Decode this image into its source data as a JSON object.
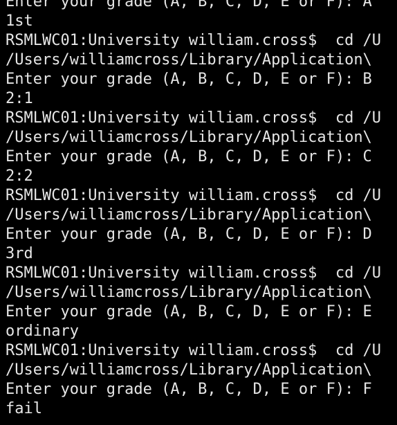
{
  "terminal": {
    "colors": {
      "background": "#000000",
      "foreground": "#e6e6e6"
    },
    "lines": [
      "Enter your grade (A, B, C, D, E or F): A",
      "1st",
      "RSMLWC01:University william.cross$  cd /U",
      "/Users/williamcross/Library/Application\\",
      "Enter your grade (A, B, C, D, E or F): B",
      "2:1",
      "RSMLWC01:University william.cross$  cd /U",
      "/Users/williamcross/Library/Application\\",
      "Enter your grade (A, B, C, D, E or F): C",
      "2:2",
      "RSMLWC01:University william.cross$  cd /U",
      "/Users/williamcross/Library/Application\\",
      "Enter your grade (A, B, C, D, E or F): D",
      "3rd",
      "RSMLWC01:University william.cross$  cd /U",
      "/Users/williamcross/Library/Application\\",
      "Enter your grade (A, B, C, D, E or F): E",
      "ordinary",
      "RSMLWC01:University william.cross$  cd /U",
      "/Users/williamcross/Library/Application\\",
      "Enter your grade (A, B, C, D, E or F): F",
      "fail"
    ]
  }
}
